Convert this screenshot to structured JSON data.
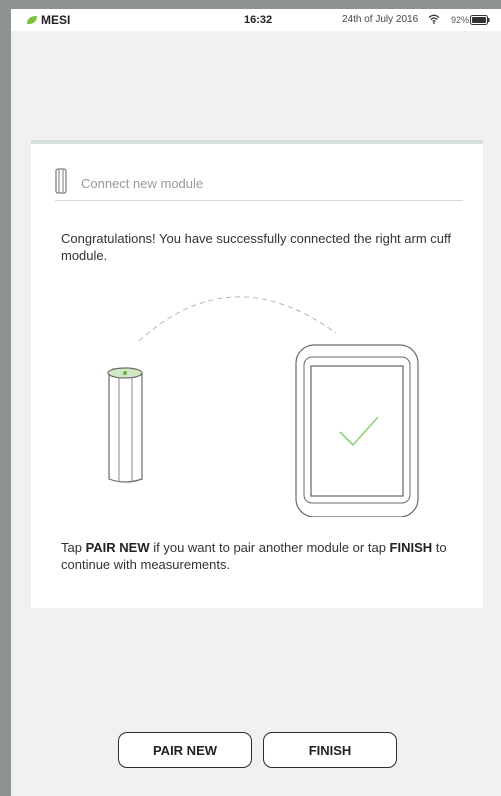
{
  "status_bar": {
    "brand": "MESI",
    "time": "16:32",
    "date": "24th of July 2016",
    "battery_pct": "92%",
    "brand_color": "#7dc242"
  },
  "card": {
    "title": "Connect new module",
    "message": "Congratulations! You have successfully connected the right arm cuff module.",
    "instructions": {
      "part1": "Tap ",
      "pair_keyword": "PAIR NEW",
      "part2": " if you want to pair another module or tap ",
      "finish_keyword": "FINISH",
      "part3": " to continue with measurements."
    },
    "accent_color": "#d3e1dc",
    "check_color": "#8fd07a"
  },
  "buttons": {
    "pair_new": "PAIR NEW",
    "finish": "FINISH"
  }
}
